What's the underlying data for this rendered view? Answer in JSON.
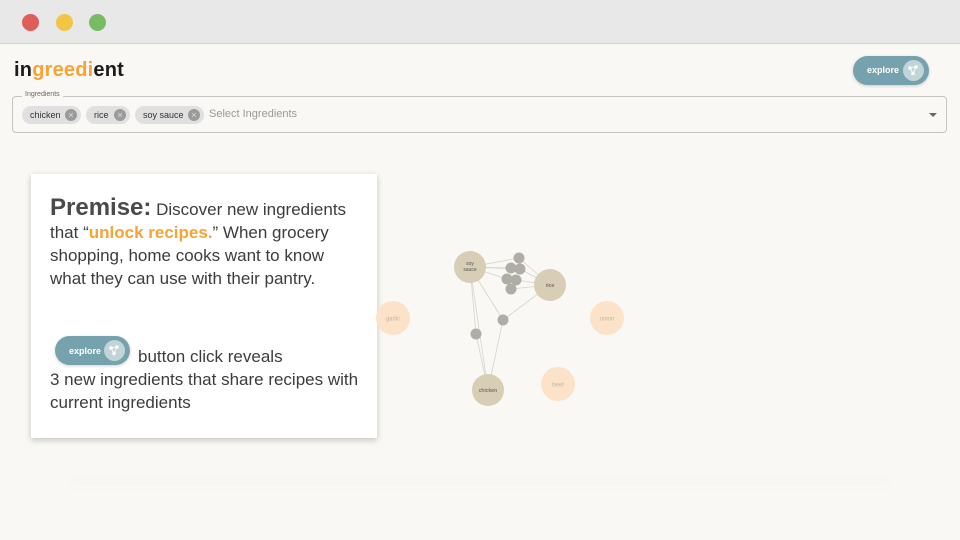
{
  "window": {
    "controls": [
      "close",
      "minimize",
      "maximize"
    ]
  },
  "header": {
    "logo": {
      "part1": "in",
      "part2": "greedi",
      "part3": "ent"
    },
    "explore_button": {
      "label": "explore",
      "icon": "network-icon"
    }
  },
  "ingredient_input": {
    "legend": "Ingredients",
    "chips": [
      "chicken",
      "rice",
      "soy sauce"
    ],
    "placeholder": "Select Ingredients"
  },
  "card": {
    "premise_label": "Premise:",
    "line_a": " Discover new ingredients that “",
    "unlock": "unlock recipes.",
    "line_b": "” When grocery shopping, home cooks want to know what they can use with their pantry.",
    "explore_label": "explore",
    "button_desc": "button click reveals",
    "highlight": "3 new ingredients",
    "rest": " that share recipes with current ingredients"
  },
  "graph": {
    "current_nodes": [
      "soy sauce",
      "rice",
      "chicken"
    ],
    "suggested_nodes": [
      "garlic",
      "onion",
      "beef"
    ],
    "colors": {
      "current": "#d8cdb5",
      "suggested": "#fbe2c8",
      "small": "#b0aca6",
      "edge": "#d6d3cc"
    }
  },
  "colors": {
    "accent": "#f6a435",
    "button": "#75a2ac"
  }
}
